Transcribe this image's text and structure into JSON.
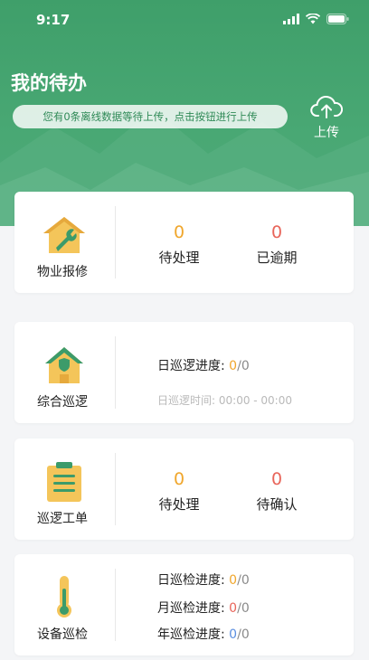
{
  "status_bar": {
    "time": "9:17"
  },
  "header": {
    "title": "我的待办",
    "notice": "您有0条离线数据等待上传，点击按钮进行上传",
    "upload_label": "上传"
  },
  "cards": [
    {
      "label": "物业报修",
      "icon": "wrench-house-icon",
      "stats": [
        {
          "value": "0",
          "caption": "待处理",
          "color": "#f0a62c"
        },
        {
          "value": "0",
          "caption": "已逾期",
          "color": "#e8655a"
        }
      ]
    },
    {
      "label": "综合巡逻",
      "icon": "shield-house-icon",
      "progress_label": "日巡逻进度:",
      "progress_done": "0",
      "progress_sep": "/",
      "progress_total": "0",
      "time_label": "日巡逻时间:",
      "time_value": "00:00 - 00:00"
    },
    {
      "label": "巡逻工单",
      "icon": "clipboard-icon",
      "stats": [
        {
          "value": "0",
          "caption": "待处理",
          "color": "#f0a62c"
        },
        {
          "value": "0",
          "caption": "待确认",
          "color": "#e8655a"
        }
      ]
    },
    {
      "label": "设备巡检",
      "icon": "thermometer-icon",
      "rows": [
        {
          "label": "日巡检进度:",
          "done": "0",
          "sep": "/",
          "total": "0"
        },
        {
          "label": "月巡检进度:",
          "done": "0",
          "sep": "/",
          "total": "0"
        },
        {
          "label": "年巡检进度:",
          "done": "0",
          "sep": "/",
          "total": "0"
        }
      ]
    }
  ]
}
